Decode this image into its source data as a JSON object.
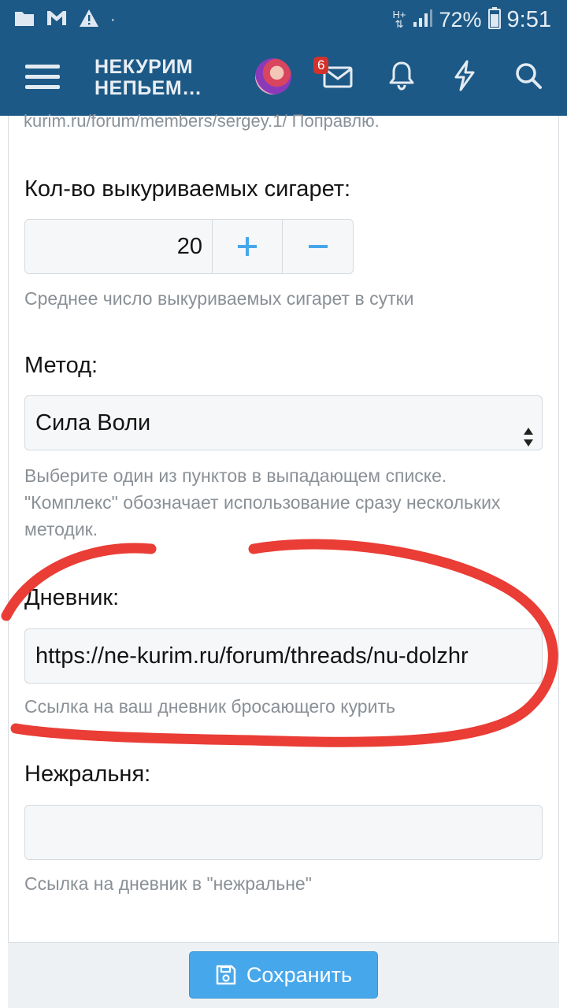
{
  "status_bar": {
    "network": "H+",
    "battery_percent": "72%",
    "time": "9:51",
    "dot": "·",
    "icons": [
      "folder-icon",
      "gmail-icon",
      "warning-icon",
      "signal-icon",
      "battery-icon"
    ]
  },
  "header": {
    "logo_line1": "НЕКУРИМ",
    "logo_line2": "НЕПЬЕМ…",
    "messages_badge": "6",
    "icons": [
      "menu-icon",
      "avatar",
      "mail-icon",
      "bell-icon",
      "lightning-icon",
      "search-icon"
    ],
    "color": "#1d5986"
  },
  "form": {
    "clipped_text": "kurim.ru/forum/members/sergey.1/ Поправлю.",
    "cigarettes": {
      "label": "Кол-во выкуриваемых сигарет:",
      "value": "20",
      "plus": "+",
      "minus": "−",
      "hint": "Среднее число выкуриваемых сигарет в сутки"
    },
    "method": {
      "label": "Метод:",
      "selected": "Сила Воли",
      "hint": "Выберите один из пунктов в выпадающем списке. \"Комплекс\" обозначает использование сразу нескольких методик."
    },
    "diary": {
      "label": "Дневник:",
      "value": "https://ne-kurim.ru/forum/threads/nu-dolzhr",
      "hint": "Ссылка на ваш дневник бросающего курить"
    },
    "nezhralnya": {
      "label": "Нежральня:",
      "value": "",
      "hint": "Ссылка на дневник в \"нежральне\""
    },
    "save_label": "Сохранить"
  },
  "colors": {
    "accent": "#47a7eb",
    "annotation": "#e8332a",
    "badge": "#d3322c"
  }
}
